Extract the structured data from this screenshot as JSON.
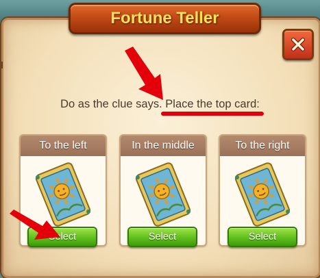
{
  "dialog": {
    "title": "Fortune Teller",
    "close_icon": "close-x-icon",
    "clue_text": "Do as the clue says. Place the top card:"
  },
  "cards": [
    {
      "label": "To the left",
      "image": "sun-tarot-card-icon",
      "button": "Select"
    },
    {
      "label": "In the middle",
      "image": "sun-tarot-card-icon",
      "button": "Select"
    },
    {
      "label": "To the right",
      "image": "sun-tarot-card-icon",
      "button": "Select"
    }
  ],
  "colors": {
    "title_text": "#ffe25a",
    "banner": "#c24a16",
    "close_button": "#d83c20",
    "select_button": "#5fbf1c",
    "annotation_red": "#e4000a"
  },
  "annotations": [
    {
      "type": "arrow",
      "points_to": "clue-text-place-the-top-card"
    },
    {
      "type": "underline",
      "target": "Place the top card:"
    },
    {
      "type": "arrow",
      "points_to": "select-button-left"
    }
  ]
}
